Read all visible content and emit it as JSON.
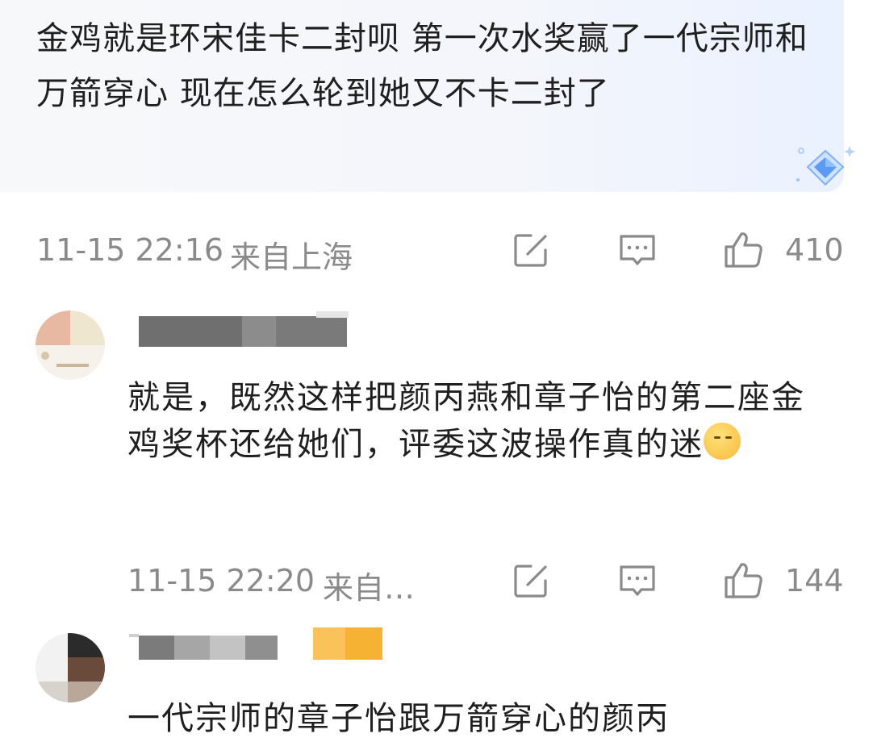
{
  "post": {
    "text": "金鸡就是环宋佳卡二封呗 第一次水奖赢了一代宗师和万箭穿心 现在怎么轮到她又不卡二封了",
    "time": "11-15 22:16",
    "location": "来自上海",
    "likes": "410"
  },
  "comments": [
    {
      "text": "就是，既然这样把颜丙燕和章子怡的第二座金鸡奖杯还给她们，评委这波操作真的迷",
      "emoji": "shush-emoji",
      "time": "11-15 22:20",
      "location": "来自…",
      "likes": "144"
    },
    {
      "text": "一代宗师的章子怡跟万箭穿心的颜丙"
    }
  ],
  "icons": {
    "repost": "edit-square-icon",
    "comment": "comment-bubble-icon",
    "like": "thumbs-up-icon",
    "badge": "diamond-badge-icon"
  },
  "colors": {
    "text": "#1f1f1f",
    "meta": "#8a8a8a",
    "card_bg": "#f4f6fb",
    "badge": "#5b9bf5"
  }
}
